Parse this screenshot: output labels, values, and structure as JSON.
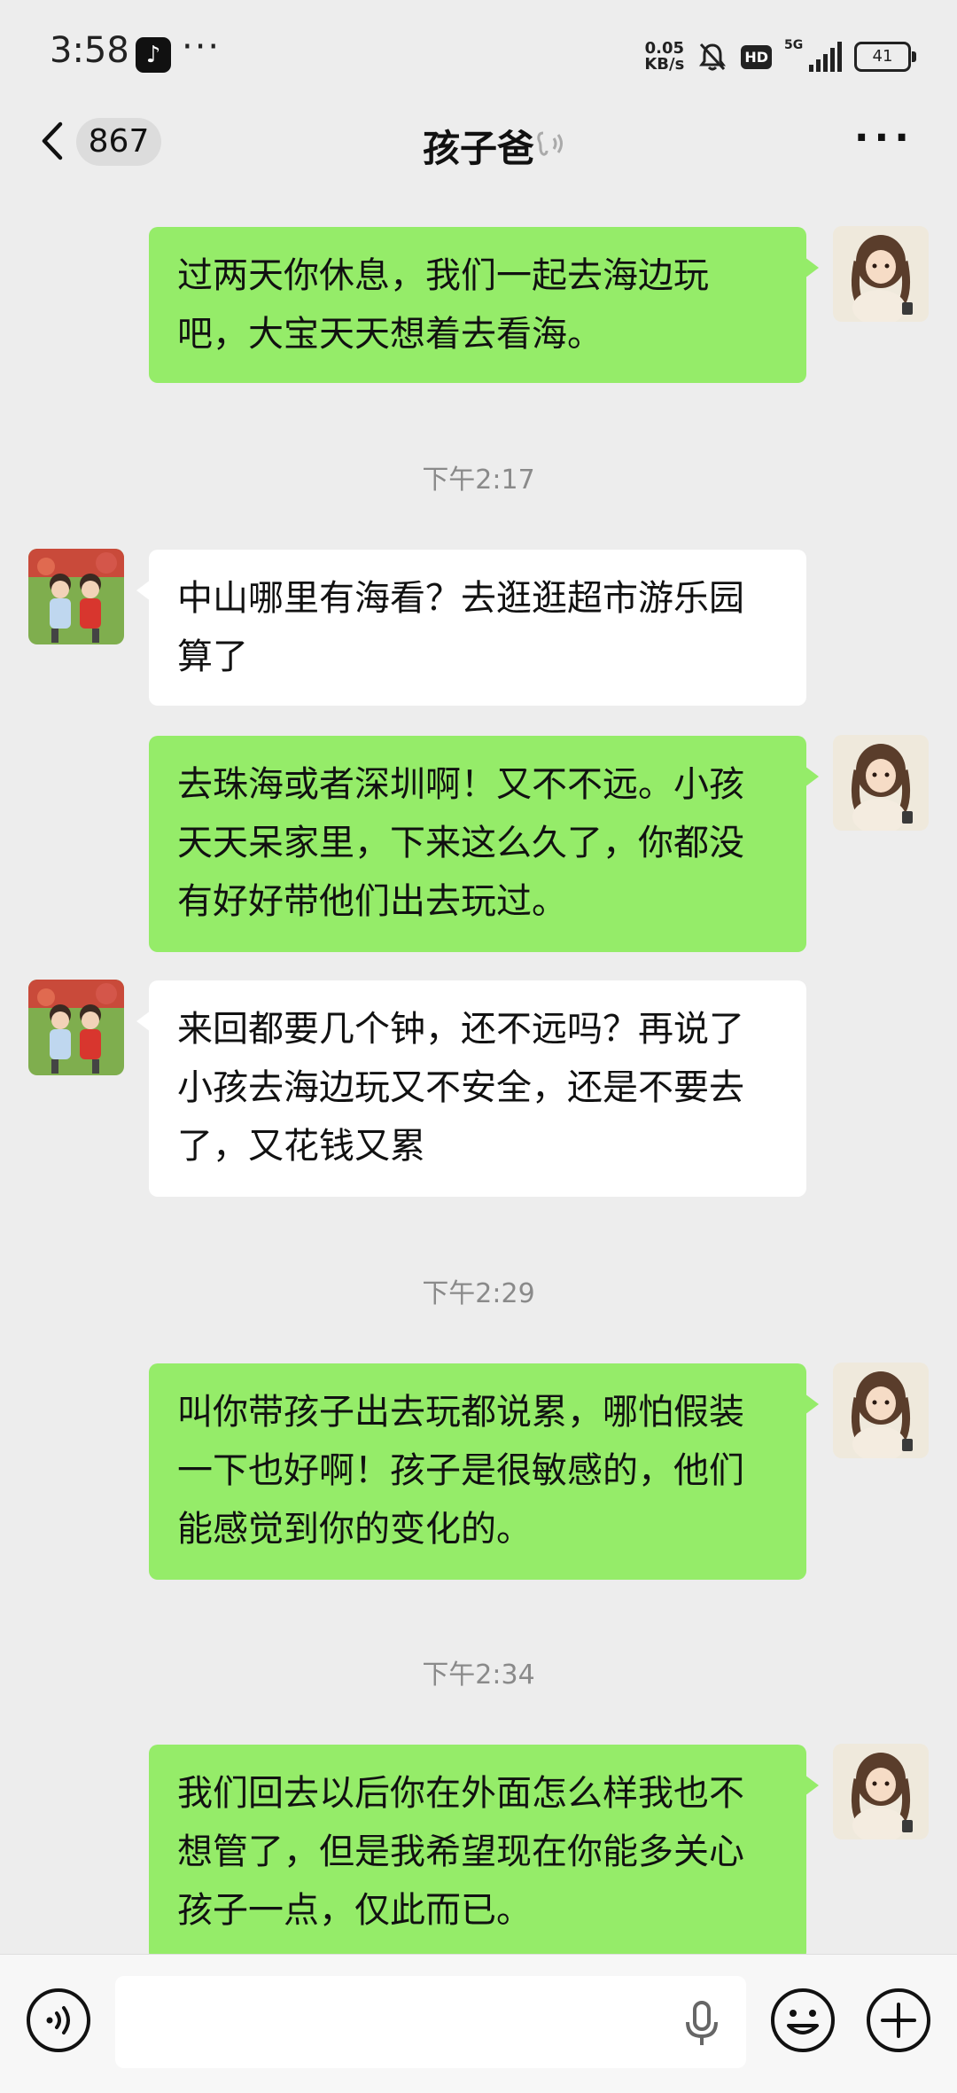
{
  "status_bar": {
    "time": "3:58",
    "tiktok_icon": "tiktok-app-icon",
    "more": "···",
    "net_speed_value": "0.05",
    "net_speed_unit": "KB/s",
    "hd": "HD",
    "network": "5G",
    "battery": "41"
  },
  "nav": {
    "unread_count": "867",
    "title": "孩子爸"
  },
  "messages": [
    {
      "side": "right",
      "text": "过两天你休息，我们一起去海边玩吧，大宝天天想着去看海。"
    },
    {
      "side": "time",
      "text": "下午2:17"
    },
    {
      "side": "left",
      "text": "中山哪里有海看？去逛逛超市游乐园算了"
    },
    {
      "side": "right",
      "text": "去珠海或者深圳啊！又不不远。小孩天天呆家里，下来这么久了，你都没有好好带他们出去玩过。"
    },
    {
      "side": "left",
      "text": "来回都要几个钟，还不远吗？再说了小孩去海边玩又不安全，还是不要去了，又花钱又累"
    },
    {
      "side": "time",
      "text": "下午2:29"
    },
    {
      "side": "right",
      "text": "叫你带孩子出去玩都说累，哪怕假装一下也好啊！孩子是很敏感的，他们能感觉到你的变化的。"
    },
    {
      "side": "time",
      "text": "下午2:34"
    },
    {
      "side": "right",
      "text": "我们回去以后你在外面怎么样我也不想管了，但是我希望现在你能多关心孩子一点，仅此而已。"
    }
  ],
  "input_bar": {
    "placeholder": ""
  },
  "colors": {
    "background": "#ededed",
    "bubble_self": "#95ec69",
    "bubble_other": "#ffffff",
    "timestamp": "#8a8a8a"
  }
}
